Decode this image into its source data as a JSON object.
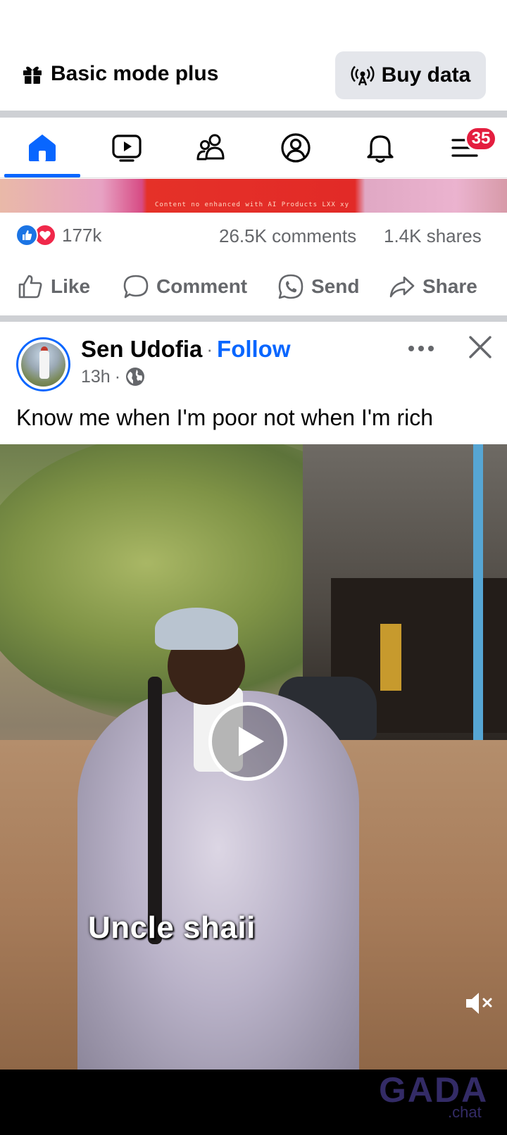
{
  "top_banner": {
    "basic_mode_label": "Basic mode plus",
    "buy_data_label": "Buy data"
  },
  "navbar": {
    "items": [
      {
        "name": "home",
        "icon": "home-icon",
        "active": true
      },
      {
        "name": "video",
        "icon": "video-icon"
      },
      {
        "name": "friends",
        "icon": "friends-icon"
      },
      {
        "name": "profile",
        "icon": "profile-icon"
      },
      {
        "name": "notifications",
        "icon": "bell-icon"
      },
      {
        "name": "menu",
        "icon": "menu-icon"
      }
    ],
    "menu_badge": "35",
    "accent_color": "#0866ff",
    "badge_color": "#e41e3f"
  },
  "previous_post": {
    "media_caption": "Content  no  enhanced  with  AI Products    LXX  xy",
    "reaction_count": "177k",
    "comments": "26.5K comments",
    "shares": "1.4K shares",
    "actions": {
      "like": "Like",
      "comment": "Comment",
      "send": "Send",
      "share": "Share"
    }
  },
  "post": {
    "author": "Sen Udofia",
    "separator": "·",
    "follow_label": "Follow",
    "time": "13h",
    "meta_separator": "·",
    "privacy_icon": "globe-icon",
    "text": "Know me when I'm poor not when I'm rich",
    "video": {
      "caption": "Uncle shaii",
      "play_icon": "play-icon",
      "mute_icon": "speaker-muted-icon"
    }
  },
  "watermark": {
    "brand": "GADA",
    "sub": ".chat"
  }
}
